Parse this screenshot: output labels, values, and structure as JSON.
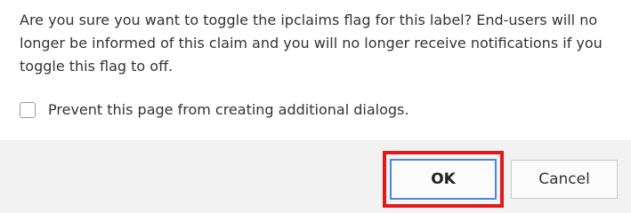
{
  "dialog": {
    "message": "Are you sure you want to toggle the ipclaims flag for this label? End-users will no longer be informed of this claim and you will no longer receive notifications if you toggle this flag to off.",
    "checkbox": {
      "label": "Prevent this page from creating additional dialogs.",
      "checked": false
    },
    "buttons": {
      "ok_label": "OK",
      "cancel_label": "Cancel"
    }
  },
  "colors": {
    "highlight": "#e11919",
    "focus_border": "#4d89d9",
    "footer_background": "#f2f2f2"
  }
}
